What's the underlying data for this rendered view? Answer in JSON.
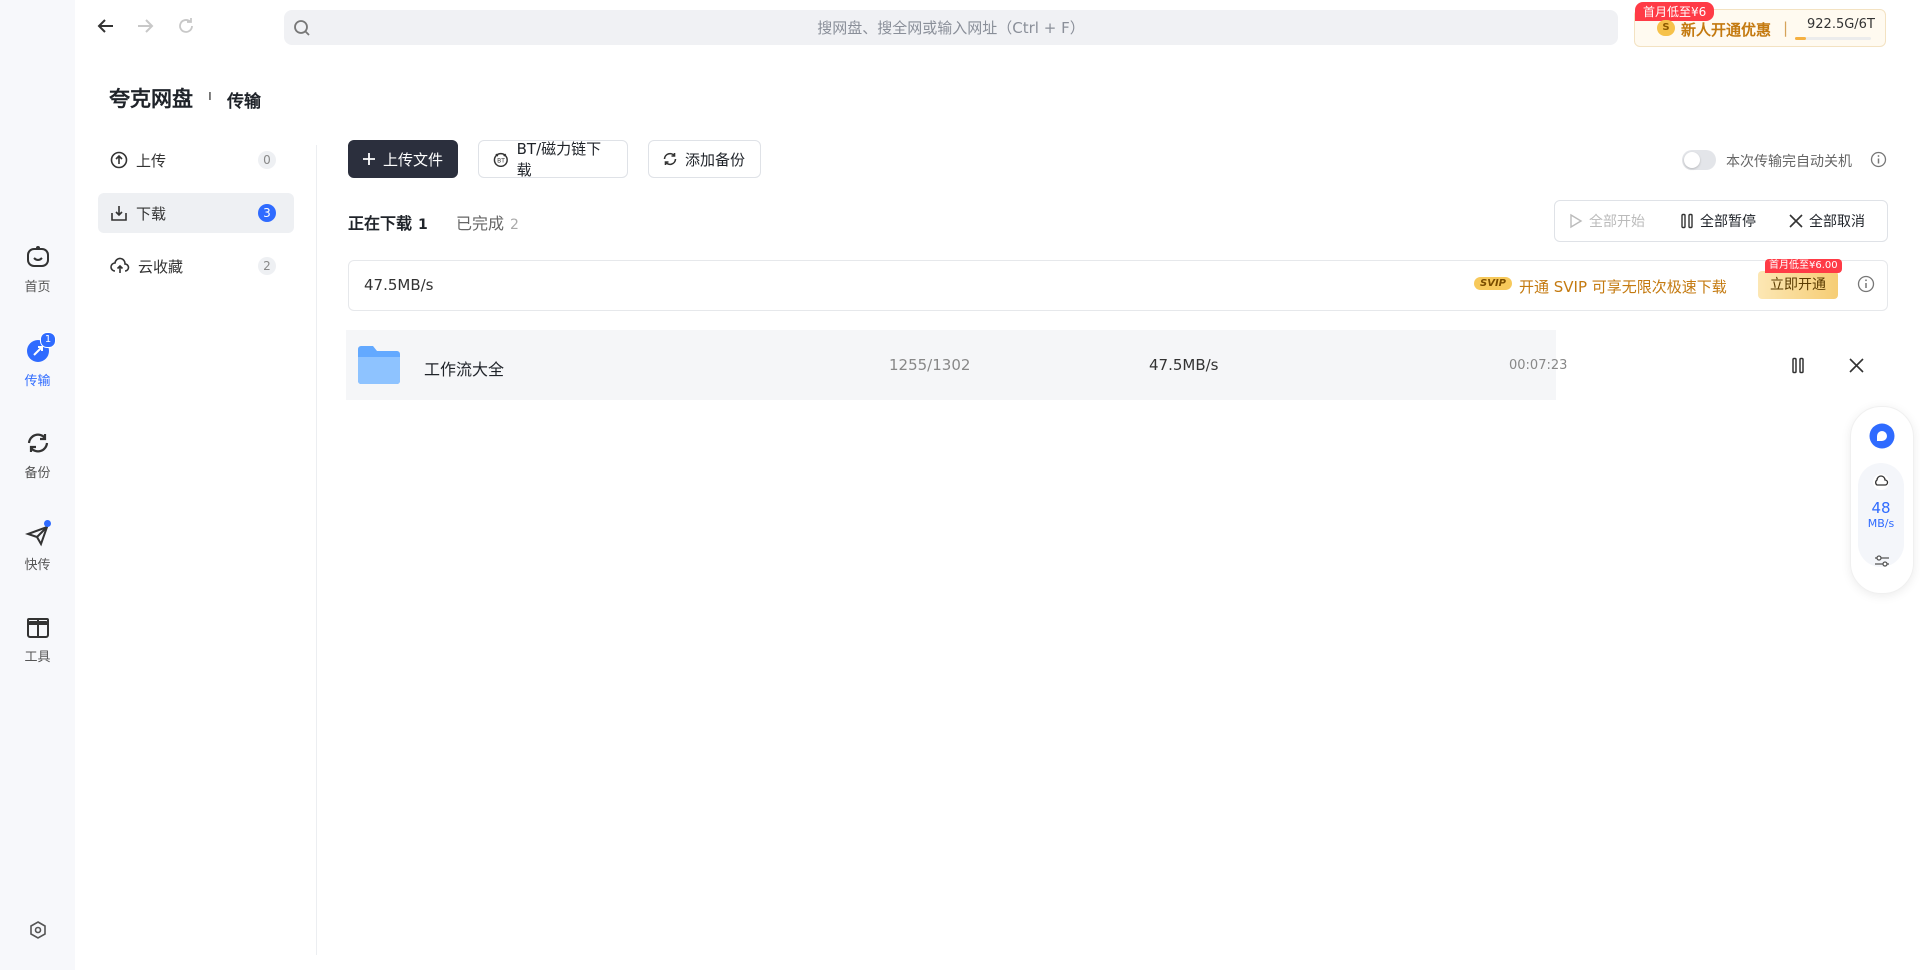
{
  "rail": {
    "items": [
      {
        "label": "首页",
        "icon": "home-icon"
      },
      {
        "label": "传输",
        "icon": "transfer-icon",
        "badge": "1",
        "active": true
      },
      {
        "label": "备份",
        "icon": "backup-icon"
      },
      {
        "label": "快传",
        "icon": "quick-send-icon"
      },
      {
        "label": "工具",
        "icon": "tools-icon"
      }
    ]
  },
  "search": {
    "placeholder": "搜网盘、搜全网或输入网址（Ctrl + F）"
  },
  "promo": {
    "tag": "首月低至¥6",
    "coin": "S",
    "text": "新人开通优惠",
    "separator": "|",
    "storage": "922.5G/6T",
    "usage_fraction": 0.15
  },
  "header": {
    "app_title": "夸克网盘",
    "separator": "ı",
    "section": "传输"
  },
  "side_menu": [
    {
      "label": "上传",
      "count": "0"
    },
    {
      "label": "下载",
      "count": "3",
      "active": true
    },
    {
      "label": "云收藏",
      "count": "2"
    }
  ],
  "toolbar": {
    "upload_label": "上传文件",
    "bt_label": "BT/磁力链下载",
    "backup_label": "添加备份",
    "shutdown_label": "本次传输完自动关机",
    "shutdown_enabled": false
  },
  "tabs": [
    {
      "label": "正在下载",
      "count": "1",
      "active": true
    },
    {
      "label": "已完成",
      "count": "2"
    }
  ],
  "group_actions": {
    "start_all": "全部开始",
    "pause_all": "全部暂停",
    "cancel_all": "全部取消"
  },
  "speed_bar": {
    "speed": "47.5MB/s",
    "svip_badge": "SVIP",
    "svip_text": "开通 SVIP 可享无限次极速下载",
    "open_tag": "首月低至¥6.00",
    "open_label": "立即开通"
  },
  "downloads": [
    {
      "name": "工作流大全",
      "progress": "1255/1302",
      "speed": "47.5MB/s",
      "time_left": "00:07:23"
    }
  ],
  "float_widget": {
    "speed_value": "48",
    "speed_unit": "MB/s"
  },
  "colors": {
    "accent": "#2f6bff",
    "primary_button": "#2b2f3d",
    "promo_text": "#c47a10",
    "badge_red": "#ff3b46"
  }
}
